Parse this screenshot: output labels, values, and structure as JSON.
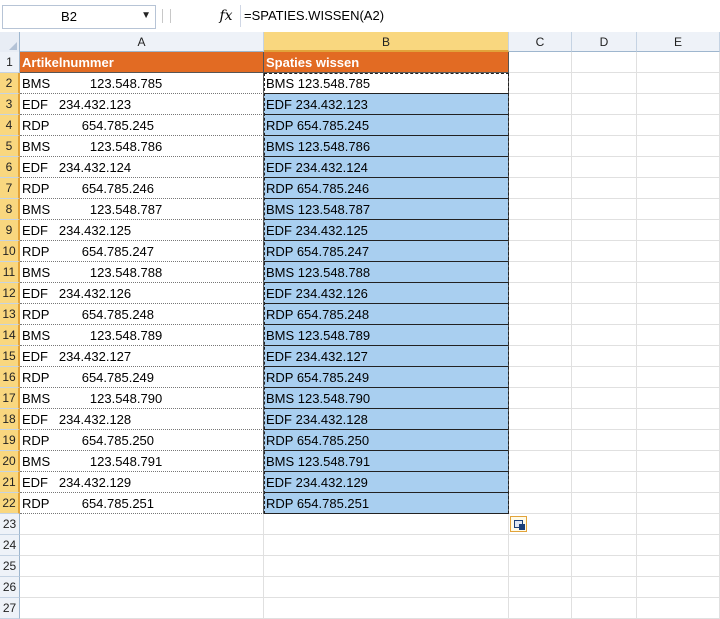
{
  "formula_bar": {
    "name_box": "B2",
    "fx_label": "fx",
    "formula": "=SPATIES.WISSEN(A2)"
  },
  "grid": {
    "columns": [
      "A",
      "B",
      "C",
      "D",
      "E"
    ],
    "selected_column": "B",
    "rows": [
      "1",
      "2",
      "3",
      "4",
      "5",
      "6",
      "7",
      "8",
      "9",
      "10",
      "11",
      "12",
      "13",
      "14",
      "15",
      "16",
      "17",
      "18",
      "19",
      "20",
      "21",
      "22",
      "23",
      "24",
      "25",
      "26",
      "27"
    ],
    "header_row": {
      "a": "Artikelnummer",
      "b": "Spaties wissen"
    },
    "data": [
      {
        "a": "BMS           123.548.785",
        "b": "BMS 123.548.785"
      },
      {
        "a": "EDF   234.432.123",
        "b": "EDF 234.432.123"
      },
      {
        "a": "RDP         654.785.245",
        "b": "RDP 654.785.245"
      },
      {
        "a": "BMS           123.548.786",
        "b": "BMS 123.548.786"
      },
      {
        "a": "EDF   234.432.124",
        "b": "EDF 234.432.124"
      },
      {
        "a": "RDP         654.785.246",
        "b": "RDP 654.785.246"
      },
      {
        "a": "BMS           123.548.787",
        "b": "BMS 123.548.787"
      },
      {
        "a": "EDF   234.432.125",
        "b": "EDF 234.432.125"
      },
      {
        "a": "RDP         654.785.247",
        "b": "RDP 654.785.247"
      },
      {
        "a": "BMS           123.548.788",
        "b": "BMS 123.548.788"
      },
      {
        "a": "EDF   234.432.126",
        "b": "EDF 234.432.126"
      },
      {
        "a": "RDP         654.785.248",
        "b": "RDP 654.785.248"
      },
      {
        "a": "BMS           123.548.789",
        "b": "BMS 123.548.789"
      },
      {
        "a": "EDF   234.432.127",
        "b": "EDF 234.432.127"
      },
      {
        "a": "RDP         654.785.249",
        "b": "RDP 654.785.249"
      },
      {
        "a": "BMS           123.548.790",
        "b": "BMS 123.548.790"
      },
      {
        "a": "EDF   234.432.128",
        "b": "EDF 234.432.128"
      },
      {
        "a": "RDP         654.785.250",
        "b": "RDP 654.785.250"
      },
      {
        "a": "BMS           123.548.791",
        "b": "BMS 123.548.791"
      },
      {
        "a": "EDF   234.432.129",
        "b": "EDF 234.432.129"
      },
      {
        "a": "RDP         654.785.251",
        "b": "RDP 654.785.251"
      }
    ]
  },
  "icons": {
    "name_box_dropdown": "chevron-down-icon",
    "function": "function-fx-icon",
    "paste_options": "paste-options-icon"
  },
  "colors": {
    "header_fill": "#e26b23",
    "selection_fill": "#a9cff0",
    "selected_header": "#f9d77f"
  }
}
